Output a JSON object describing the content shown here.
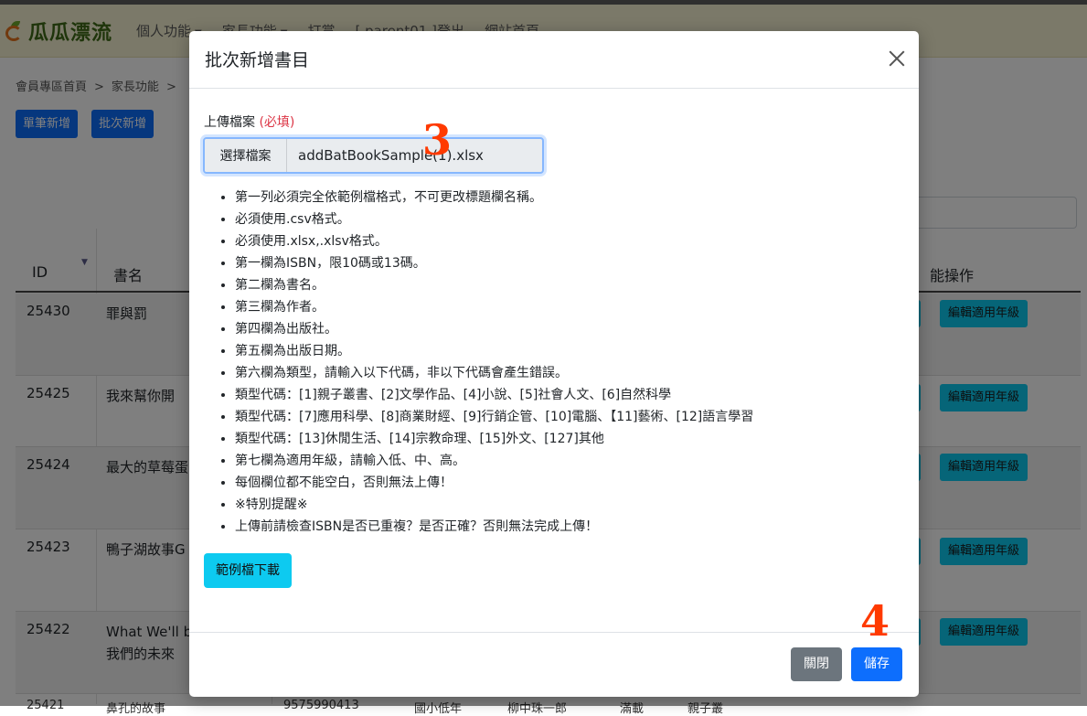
{
  "navbar": {
    "logo_text": "瓜瓜漂流",
    "items": [
      "個人功能",
      "家長功能",
      "打賞",
      "[ parent01 ]登出",
      "網站首頁"
    ]
  },
  "breadcrumb": [
    "會員專區首頁",
    "家長功能"
  ],
  "page_buttons": {
    "single_add": "單筆新增",
    "batch_add": "批次新增"
  },
  "table": {
    "headers": {
      "id": "ID",
      "title": "書名",
      "actions": "能操作"
    },
    "rows": [
      {
        "id": "25430",
        "title": "罪與罰",
        "title2": ""
      },
      {
        "id": "25425",
        "title": "我來幫你開",
        "title2": ""
      },
      {
        "id": "25424",
        "title": "最大的草莓蛋",
        "title2": ""
      },
      {
        "id": "25423",
        "title": "鴨子湖故事G",
        "title2": ""
      },
      {
        "id": "25422",
        "title": "What We'll b",
        "title2": "我們的未來"
      }
    ],
    "edit_grade_label": "編輯適用年級",
    "partial_row": [
      "25421",
      "鼻孔的故事",
      "9575990413",
      "國小低年",
      "柳中珠一郎",
      "滿載",
      "親子叢"
    ]
  },
  "modal": {
    "title": "批次新增書目",
    "upload_label": "上傳檔案",
    "required_label": "(必填)",
    "file_button": "選擇檔案",
    "file_name": "addBatBookSample(1).xlsx",
    "rules": [
      "第一列必須完全依範例檔格式，不可更改標題欄名稱。",
      "必須使用.csv格式。",
      "必須使用.xlsx,.xlsv格式。",
      "第一欄為ISBN，限10碼或13碼。",
      "第二欄為書名。",
      "第三欄為作者。",
      "第四欄為出版社。",
      "第五欄為出版日期。",
      "第六欄為類型，請輸入以下代碼，非以下代碼會產生錯誤。",
      "類型代碼：[1]親子叢書、[2]文學作品、[4]小說、[5]社會人文、[6]自然科學",
      "類型代碼：[7]應用科學、[8]商業財經、[9]行銷企管、[10]電腦、【11]藝術、[12]語言學習",
      "類型代碼：[13]休閒生活、[14]宗教命理、[15]外文、[127]其他",
      "第七欄為適用年級，請輸入低、中、高。",
      "每個欄位都不能空白，否則無法上傳！",
      "※特別提醒※",
      "上傳前請檢查ISBN是否已重複？是否正確？否則無法完成上傳！"
    ],
    "sample_button": "範例檔下載",
    "close_button": "關閉",
    "save_button": "儲存"
  },
  "annotations": [
    "3",
    "4"
  ],
  "colors": {
    "primary": "#0d6efd",
    "info": "#0dcaf0",
    "secondary": "#6c757d",
    "required": "#dc3545",
    "annotation": "#ff3a00"
  }
}
